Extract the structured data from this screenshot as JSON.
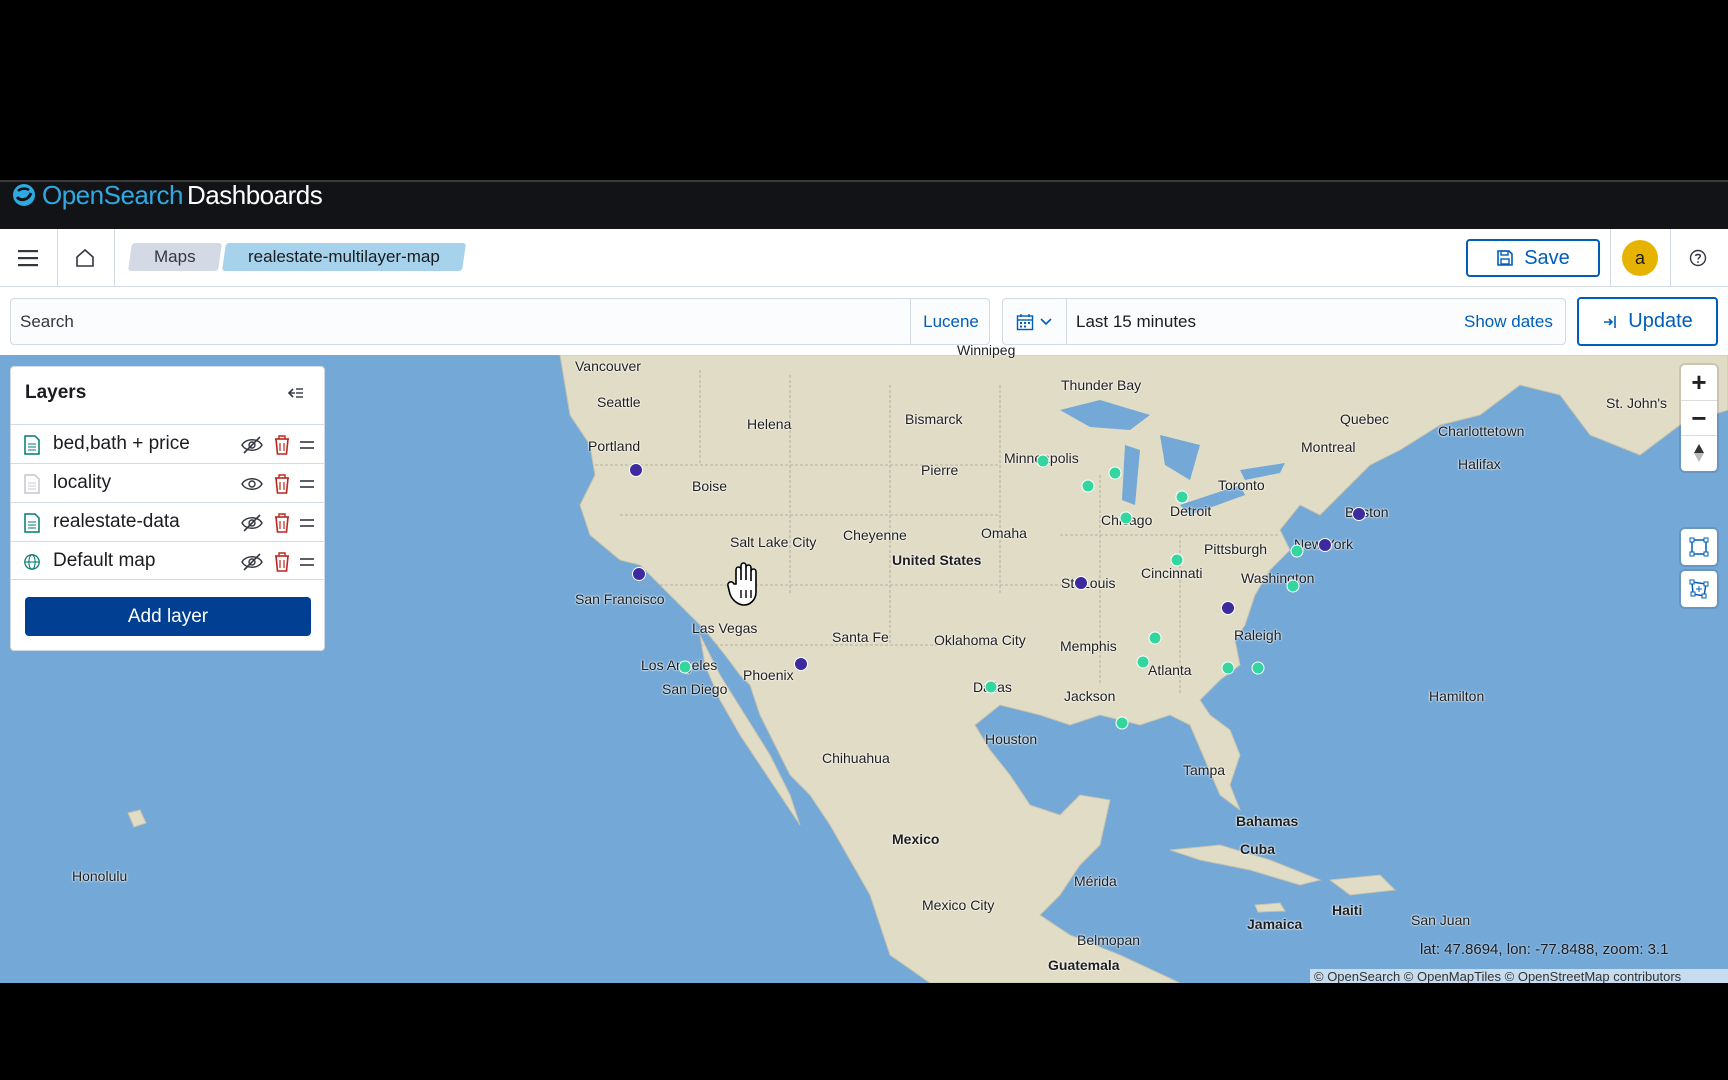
{
  "header": {
    "brand_open": "Open",
    "brand_search": "Search",
    "brand_dashboards": "Dashboards"
  },
  "nav": {
    "breadcrumbs": [
      {
        "label": "Maps"
      },
      {
        "label": "realestate-multilayer-map"
      }
    ],
    "save_label": "Save",
    "avatar_initial": "a"
  },
  "query": {
    "search_placeholder": "Search",
    "language": "Lucene",
    "time_range": "Last 15 minutes",
    "show_dates": "Show dates",
    "update_label": "Update"
  },
  "layers_panel": {
    "title": "Layers",
    "layers": [
      {
        "name": "bed,bath + price",
        "type": "document",
        "visible": false
      },
      {
        "name": "locality",
        "type": "document",
        "visible": true
      },
      {
        "name": "realestate-data",
        "type": "document",
        "visible": false
      },
      {
        "name": "Default map",
        "type": "globe",
        "visible": false
      }
    ],
    "add_layer": "Add layer"
  },
  "map": {
    "zoom_in": "+",
    "zoom_out": "−",
    "status": "lat: 47.8694, lon: -77.8488, zoom: 3.1",
    "attribution": "© OpenSearch © OpenMapTiles © OpenStreetMap contributors",
    "country_labels": [
      "United States",
      "Mexico",
      "Cuba",
      "Haiti",
      "Jamaica",
      "Bahamas",
      "Guatemala",
      "Belmopan"
    ],
    "city_labels": [
      "Vancouver",
      "Winnipeg",
      "Thunder Bay",
      "Quebec",
      "St. John's",
      "Seattle",
      "Helena",
      "Bismarck",
      "Montreal",
      "Charlottetown",
      "Portland",
      "Minneapolis",
      "Halifax",
      "Boise",
      "Pierre",
      "Toronto",
      "Boston",
      "Detroit",
      "Chicago",
      "Salt Lake City",
      "Cheyenne",
      "Omaha",
      "Pittsburgh",
      "New York",
      "Cincinnati",
      "Washington",
      "San Francisco",
      "St. Louis",
      "Las Vegas",
      "Santa Fe",
      "Oklahoma City",
      "Memphis",
      "Raleigh",
      "Los Angeles",
      "Phoenix",
      "Atlanta",
      "San Diego",
      "Dallas",
      "Jackson",
      "Hamilton",
      "Houston",
      "Chihuahua",
      "Tampa",
      "Honolulu",
      "Mérida",
      "Mexico City",
      "San Juan"
    ],
    "colors": {
      "ocean": "#74a8d6",
      "land": "#e0dcc6",
      "purple_points": "#3c2a9e",
      "green_points": "#33d69f"
    }
  }
}
